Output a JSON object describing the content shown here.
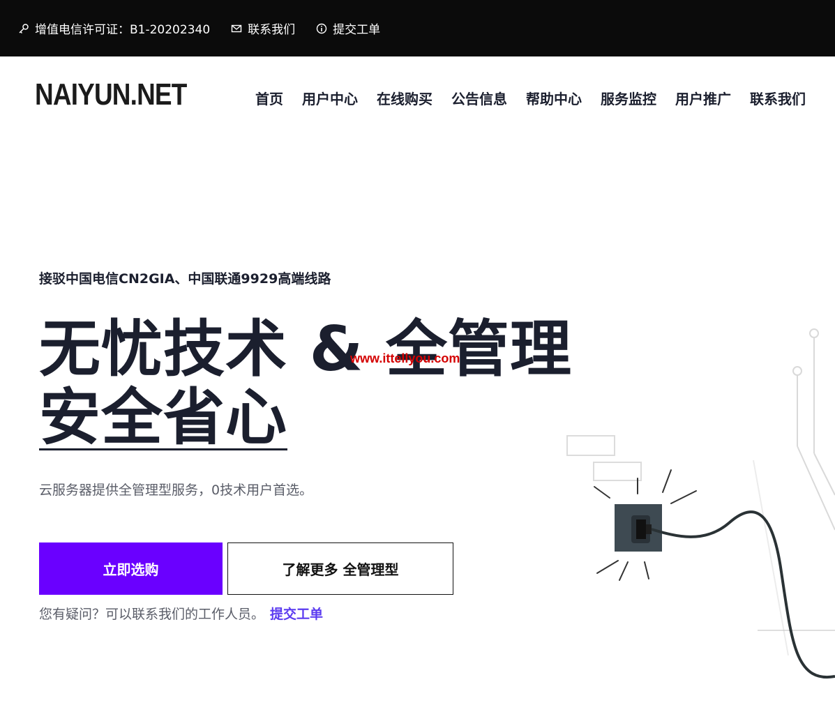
{
  "topbar": {
    "license_label": "增值电信许可证：B1-20202340",
    "contact_label": "联系我们",
    "ticket_label": "提交工单"
  },
  "header": {
    "logo": "NAIYUN.NET",
    "nav": [
      "首页",
      "用户中心",
      "在线购买",
      "公告信息",
      "帮助中心",
      "服务监控",
      "用户推广",
      "联系我们"
    ]
  },
  "hero": {
    "tagline": "接驳中国电信CN2GIA、中国联通9929高端线路",
    "headline_line1": "无忧技术 & 全管理",
    "headline_line2": "安全省心",
    "watermark": "www.ittellyou.com",
    "description": "云服务器提供全管理型服务，0技术用户首选。",
    "primary_button": "立即选购",
    "secondary_button": "了解更多 全管理型",
    "contact_text": "您有疑问？可以联系我们的工作人员。",
    "contact_link": "提交工单"
  },
  "colors": {
    "accent": "#6a00ff",
    "link": "#5b3bf0",
    "topbar_bg": "#0b0b0b",
    "text_dark": "#1b1f2e"
  }
}
